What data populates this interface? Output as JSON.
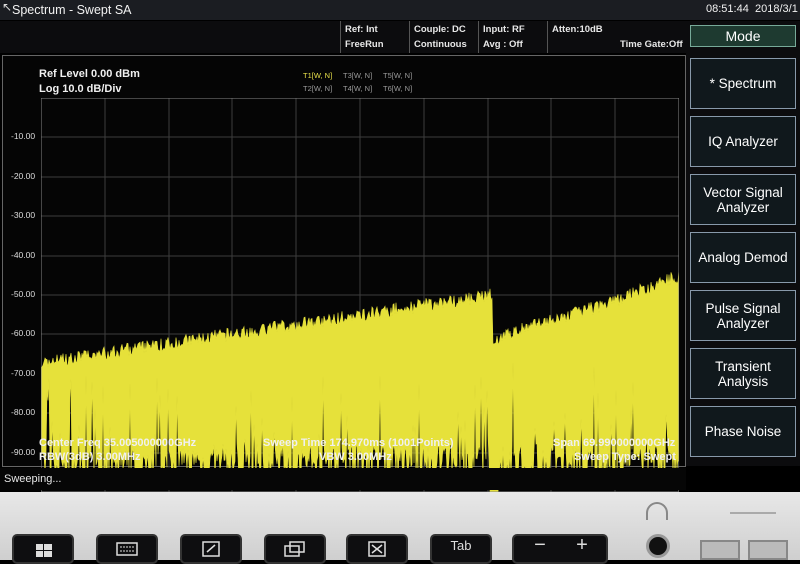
{
  "titlebar": {
    "title": "Spectrum - Swept SA",
    "time": "08:51:44",
    "date": "2018/3/1"
  },
  "status": {
    "ref": "Ref: Int",
    "run": "FreeRun",
    "couple": "Couple: DC",
    "cont": "Continuous",
    "input": "Input: RF",
    "avg": "Avg : Off",
    "atten": "Atten:10dB",
    "timegate": "Time Gate:Off"
  },
  "plot": {
    "ref_level": "Ref Level 0.00 dBm",
    "scale": "Log 10.0 dB/Div",
    "traces": {
      "t1": "T1[W, N]",
      "t2": "T2[W, N]",
      "t3": "T3[W, N]",
      "t4": "T4[W, N]",
      "t5": "T5[W, N]",
      "t6": "T6[W, N]"
    },
    "y_labels": [
      "-10.00",
      "-20.00",
      "-30.00",
      "-40.00",
      "-50.00",
      "-60.00",
      "-70.00",
      "-80.00",
      "-90.00"
    ],
    "trace_color": "#e6e13a",
    "center_freq": "Center Freq 35.005000000GHz",
    "rbw": "RBW(3dB) 3.00MHz",
    "sweep_time": "Sweep Time 174.970ms (1001Points)",
    "vbw": "VBW 3.00MHz",
    "span": "Span 69.990000000GHz",
    "sweep_type": "Sweep Type: Swept"
  },
  "softkeys": {
    "mode": "Mode",
    "items": [
      "* Spectrum",
      "IQ Analyzer",
      "Vector Signal Analyzer",
      "Analog Demod",
      "Pulse Signal Analyzer",
      "Transient Analysis",
      "Phase Noise"
    ]
  },
  "bottom_status": "Sweeping...",
  "hardkeys": {
    "tab": "Tab",
    "minus": "−",
    "plus": "+"
  }
}
